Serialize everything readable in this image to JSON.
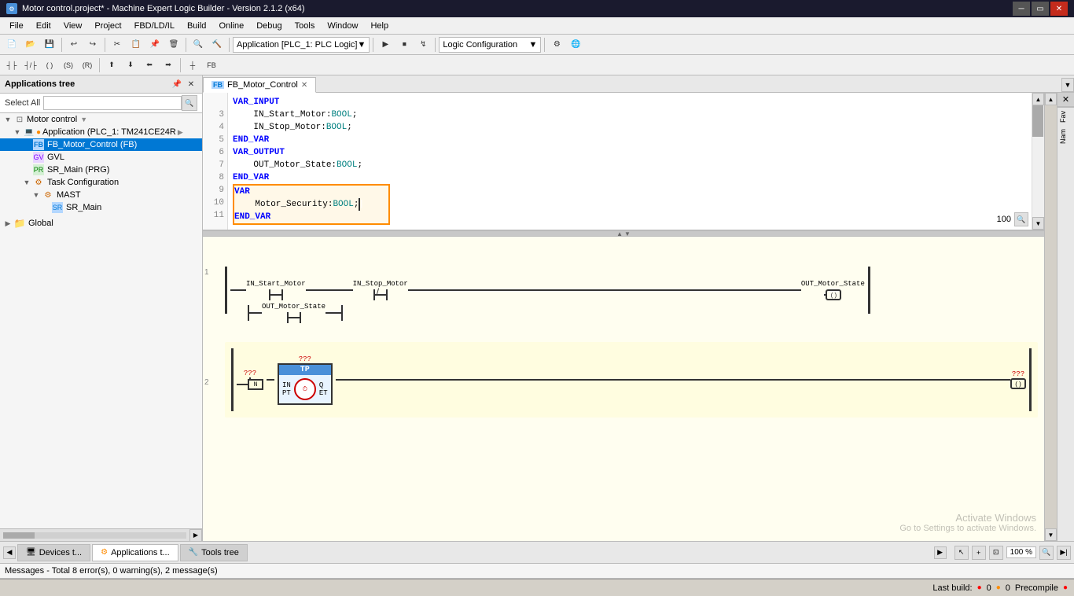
{
  "window": {
    "title": "Motor control.project* - Machine Expert Logic Builder - Version 2.1.2 (x64)"
  },
  "menu": {
    "items": [
      "File",
      "Edit",
      "View",
      "Project",
      "FBD/LD/IL",
      "Build",
      "Online",
      "Debug",
      "Tools",
      "Window",
      "Help"
    ]
  },
  "tabs": {
    "open": [
      "FB_Motor_Control"
    ]
  },
  "left_panel": {
    "title": "Applications tree",
    "select_label": "Select All",
    "tree": [
      {
        "level": 0,
        "label": "Motor control",
        "type": "root",
        "expanded": true
      },
      {
        "level": 1,
        "label": "Application (PLC_1: TM241CE24R)",
        "type": "app",
        "expanded": true
      },
      {
        "level": 2,
        "label": "FB_Motor_Control (FB)",
        "type": "fb",
        "expanded": false,
        "selected": true
      },
      {
        "level": 2,
        "label": "GVL",
        "type": "gvl",
        "expanded": false
      },
      {
        "level": 2,
        "label": "SR_Main (PRG)",
        "type": "prg",
        "expanded": false
      },
      {
        "level": 2,
        "label": "Task Configuration",
        "type": "task",
        "expanded": true
      },
      {
        "level": 3,
        "label": "MAST",
        "type": "mast",
        "expanded": true
      },
      {
        "level": 4,
        "label": "SR_Main",
        "type": "sr",
        "expanded": false
      },
      {
        "level": 0,
        "label": "Global",
        "type": "global",
        "expanded": false
      }
    ]
  },
  "code": {
    "lines": [
      {
        "num": "",
        "text": "VAR_INPUT",
        "highlight": false
      },
      {
        "num": "3",
        "text": "    IN_Start_Motor:BOOL;",
        "highlight": false
      },
      {
        "num": "4",
        "text": "    IN_Stop_Motor:BOOL;",
        "highlight": false
      },
      {
        "num": "5",
        "text": "END_VAR",
        "highlight": false
      },
      {
        "num": "6",
        "text": "VAR_OUTPUT",
        "highlight": false
      },
      {
        "num": "7",
        "text": "    OUT_Motor_State:BOOL;",
        "highlight": false
      },
      {
        "num": "8",
        "text": "END_VAR",
        "highlight": false
      },
      {
        "num": "9",
        "text": "VAR",
        "highlight": true,
        "selected": true
      },
      {
        "num": "10",
        "text": "    Motor_Security:BOOL;",
        "highlight": true,
        "selected": true
      },
      {
        "num": "11",
        "text": "END_VAR",
        "highlight": true,
        "selected": true
      }
    ],
    "keywords": [
      "VAR_INPUT",
      "END_VAR",
      "VAR_OUTPUT",
      "VAR"
    ],
    "zoom": "100"
  },
  "ladder": {
    "rung1": {
      "contacts": [
        {
          "label": "IN_Start_Motor",
          "type": "NO"
        },
        {
          "label": "IN_Stop_Motor",
          "type": "NC"
        }
      ],
      "coil_label": "OUT_Motor_State",
      "parallel_contact": {
        "label": "OUT_Motor_State",
        "type": "NO"
      }
    },
    "rung2": {
      "label": "???",
      "fb_name": "TP",
      "fb_label": "???",
      "coil_label": "???"
    }
  },
  "bottom_tabs": {
    "items": [
      "Devices t...",
      "Applications t...",
      "Tools tree"
    ],
    "active": 1
  },
  "messages": {
    "text": "Messages - Total 8 error(s), 0 warning(s), 2 message(s)"
  },
  "statusbar": {
    "last_build": "Last build:",
    "errors": "0",
    "warnings": "0",
    "precompile": "Precompile",
    "activate_windows": "Activate Windows",
    "activate_msg": "Go to Settings to activate Windows."
  },
  "toolbar_dropdown": "Application [PLC_1: PLC Logic]",
  "logic_dropdown": "Logic Configuration",
  "right_panels": {
    "fav_label": "Fav",
    "name_label": "Nam"
  }
}
